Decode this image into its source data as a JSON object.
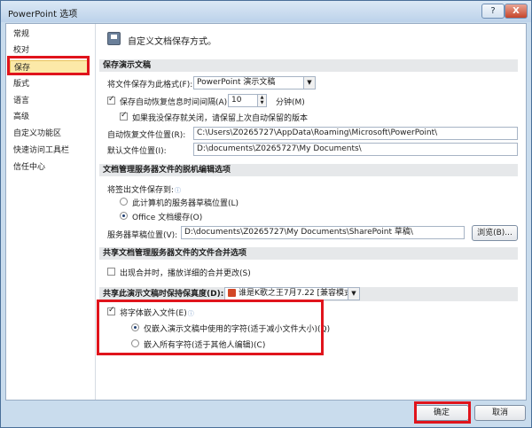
{
  "window": {
    "title": "PowerPoint 选项",
    "help_label": "?",
    "close_label": "X"
  },
  "nav": {
    "items": [
      {
        "label": "常规"
      },
      {
        "label": "校对"
      },
      {
        "label": "保存"
      },
      {
        "label": "版式"
      },
      {
        "label": "语言"
      },
      {
        "label": "高级"
      },
      {
        "label": "自定义功能区"
      },
      {
        "label": "快速访问工具栏"
      },
      {
        "label": "信任中心"
      }
    ],
    "selected": "保存"
  },
  "header": {
    "title": "自定义文档保存方式。"
  },
  "save_section": {
    "title": "保存演示文稿",
    "format_label": "将文件保存为此格式(F):",
    "format_value": "PowerPoint 演示文稿",
    "autorecover_label": "保存自动恢复信息时间间隔(A)",
    "autorecover_checked": true,
    "autorecover_minutes": "10",
    "minutes_label": "分钟(M)",
    "keep_last_label": "如果我没保存就关闭，请保留上次自动保留的版本",
    "keep_last_checked": true,
    "autorecover_location_label": "自动恢复文件位置(R):",
    "autorecover_location_value": "C:\\Users\\Z0265727\\AppData\\Roaming\\Microsoft\\PowerPoint\\",
    "default_location_label": "默认文件位置(I):",
    "default_location_value": "D:\\documents\\Z0265727\\My Documents\\"
  },
  "offline_section": {
    "title": "文档管理服务器文件的脱机编辑选项",
    "checkout_label": "将签出文件保存到:",
    "option_server_label": "此计算机的服务器草稿位置(L)",
    "option_cache_label": "Office 文档缓存(O)",
    "selected": "cache",
    "drafts_label": "服务器草稿位置(V):",
    "drafts_value": "D:\\documents\\Z0265727\\My Documents\\SharePoint 草稿\\",
    "browse_label": "浏览(B)..."
  },
  "merge_section": {
    "title": "共享文档管理服务器文件的文件合并选项",
    "merge_label": "出现合并时，播放详细的合并更改(S)",
    "merge_checked": false
  },
  "fidelity_section": {
    "label": "共享此演示文稿时保持保真度(D):",
    "doc_value": "谁是K歌之王7月7.22 [兼容模式]",
    "embed_label": "将字体嵌入文件(E)",
    "embed_checked": true,
    "embed_used_label": "仅嵌入演示文稿中使用的字符(适于减小文件大小)(Q)",
    "embed_all_label": "嵌入所有字符(适于其他人编辑)(C)",
    "embed_selected": "used"
  },
  "footer": {
    "ok_label": "确定",
    "cancel_label": "取消"
  },
  "colors": {
    "highlight_red": "#e0141c",
    "nav_selected": "#fce9a8"
  }
}
